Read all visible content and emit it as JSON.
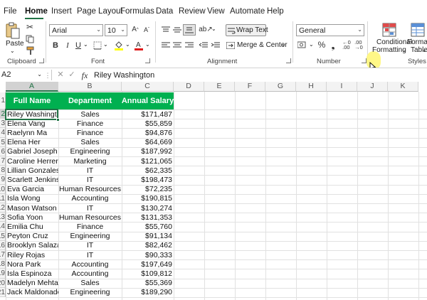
{
  "menu": {
    "tabs": [
      "File",
      "Home",
      "Insert",
      "Page Layout",
      "Formulas",
      "Data",
      "Review",
      "View",
      "Automate",
      "Help"
    ]
  },
  "ribbon": {
    "clipboard": {
      "paste_label": "Paste",
      "group_label": "Clipboard"
    },
    "font": {
      "font_name": "Arial",
      "font_size": "10",
      "group_label": "Font"
    },
    "alignment": {
      "wrap_text": "Wrap Text",
      "merge_center": "Merge & Center",
      "group_label": "Alignment"
    },
    "number": {
      "format": "General",
      "group_label": "Number"
    },
    "styles": {
      "conditional_line1": "Conditional",
      "conditional_line2": "Formatting",
      "format_table_line1": "Format",
      "format_table_line2": "Table",
      "group_label": "Styles"
    }
  },
  "formula_bar": {
    "name_box": "A2",
    "fx": "fx",
    "content": "Riley Washington"
  },
  "sheet": {
    "columns": [
      "A",
      "B",
      "C",
      "D",
      "E",
      "F",
      "G",
      "H",
      "I",
      "J",
      "K"
    ],
    "row_numbers": [
      "1",
      "2",
      "3",
      "4",
      "5",
      "6",
      "7",
      "8",
      "9",
      "10",
      "11",
      "12",
      "13",
      "14",
      "15",
      "16",
      "17",
      "18",
      "19",
      "20",
      "21"
    ],
    "headers": {
      "name": "Full Name",
      "department": "Department",
      "salary": "Annual Salary"
    },
    "rows": [
      [
        "Riley Washington",
        "Sales",
        "$171,487"
      ],
      [
        "Elena Vang",
        "Finance",
        "$55,859"
      ],
      [
        "Raelynn Ma",
        "Finance",
        "$94,876"
      ],
      [
        "Elena Her",
        "Sales",
        "$64,669"
      ],
      [
        "Gabriel Joseph",
        "Engineering",
        "$187,992"
      ],
      [
        "Caroline Herrera",
        "Marketing",
        "$121,065"
      ],
      [
        "Lillian Gonzales",
        "IT",
        "$62,335"
      ],
      [
        "Scarlett Jenkins",
        "IT",
        "$198,473"
      ],
      [
        "Eva Garcia",
        "Human Resources",
        "$72,235"
      ],
      [
        "Isla Wong",
        "Accounting",
        "$190,815"
      ],
      [
        "Mason Watson",
        "IT",
        "$130,274"
      ],
      [
        "Sofia Yoon",
        "Human Resources",
        "$131,353"
      ],
      [
        "Emilia Chu",
        "Finance",
        "$55,760"
      ],
      [
        "Peyton Cruz",
        "Engineering",
        "$91,134"
      ],
      [
        "Brooklyn Salazar",
        "IT",
        "$82,462"
      ],
      [
        "Riley Rojas",
        "IT",
        "$90,333"
      ],
      [
        "Nora Park",
        "Accounting",
        "$197,649"
      ],
      [
        "Isla Espinoza",
        "Accounting",
        "$109,812"
      ],
      [
        "Madelyn Mehta",
        "Sales",
        "$55,369"
      ],
      [
        "Jack Maldonado",
        "Engineering",
        "$189,290"
      ]
    ]
  },
  "colors": {
    "accent": "#217346",
    "header_fill": "#00b050",
    "highlight": "#fff67a"
  }
}
